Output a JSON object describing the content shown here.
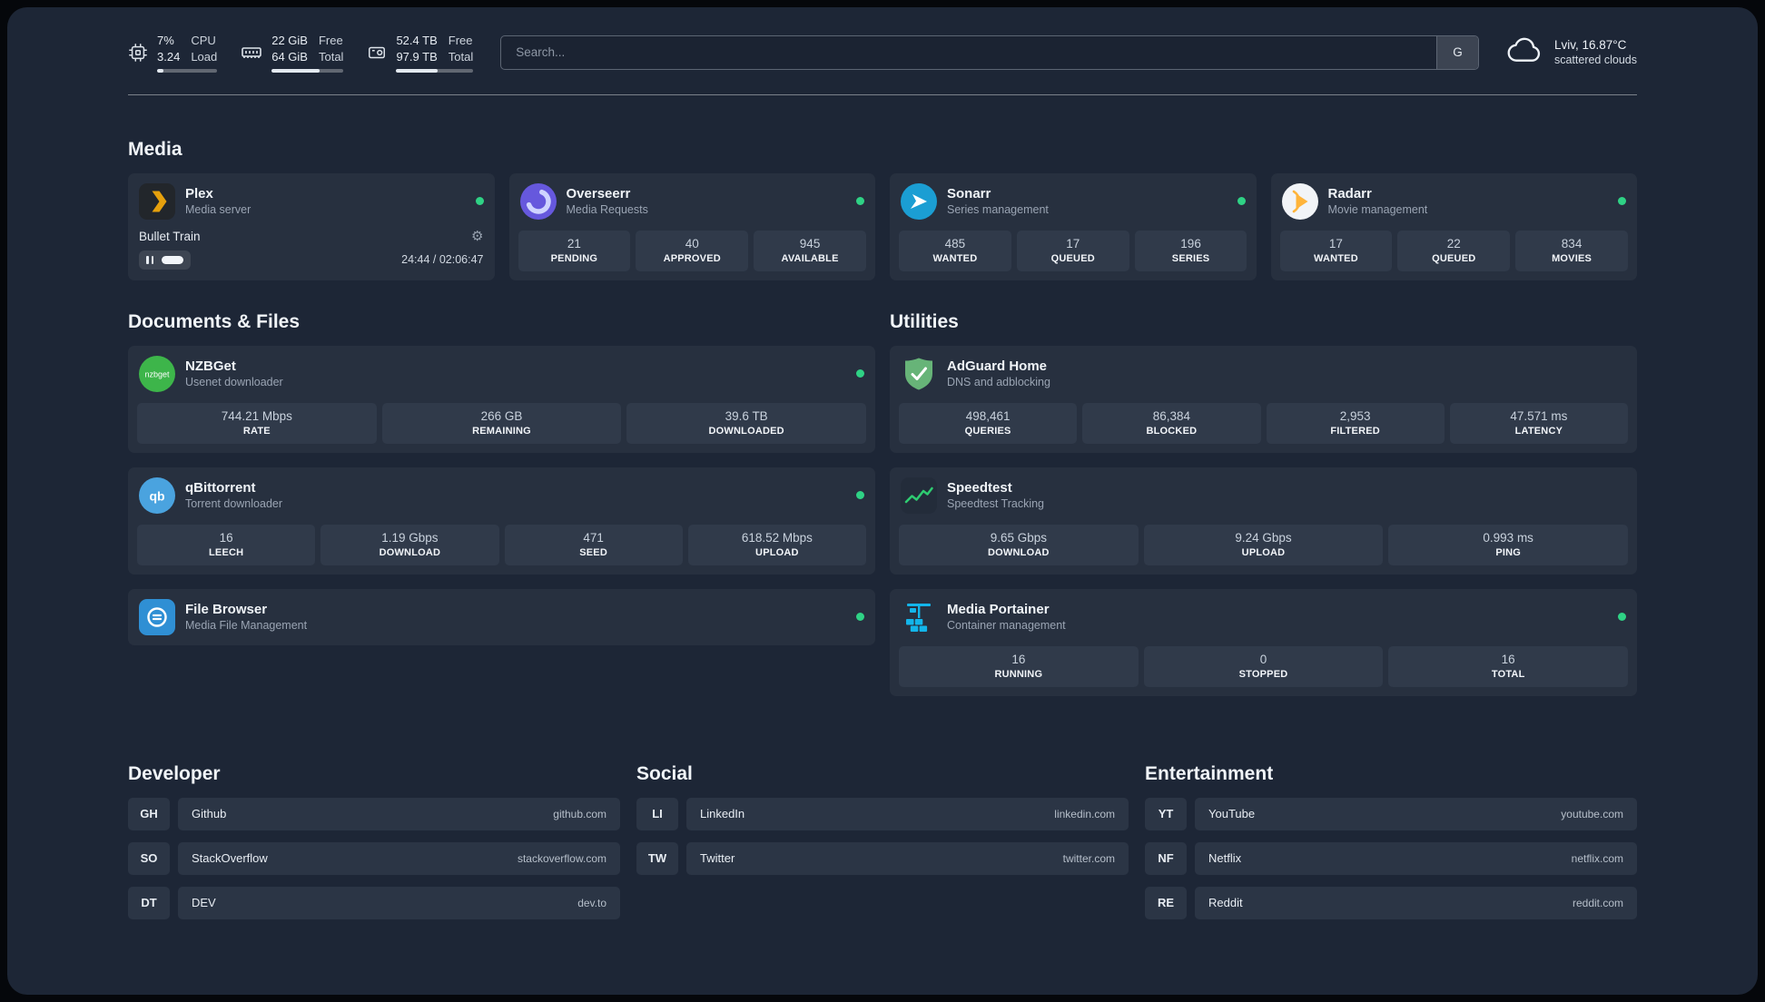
{
  "theme": {
    "background": "#1d2636",
    "card": "#27303f",
    "tile": "#303a4a",
    "status_green": "#2fd285",
    "plex_gold": "#e5a00d",
    "overseerr_purple": "#6658dd",
    "sonarr_blue": "#1b9ed3",
    "radarr_orange": "#ffb43a",
    "nzbget_green": "#3db54a",
    "qbittorrent_blue": "#4aa3df",
    "filebrowser_blue": "#2f8fd4",
    "adguard_green": "#67b478",
    "speedtest_green": "#2ecc71",
    "portainer_blue": "#13b5ea"
  },
  "topbar": {
    "cpu": {
      "percent": "7%",
      "load": "3.24",
      "label_top": "CPU",
      "label_bottom": "Load"
    },
    "memory": {
      "free": "22 GiB",
      "total": "64 GiB",
      "label_top": "Free",
      "label_bottom": "Total"
    },
    "disk": {
      "free": "52.4 TB",
      "total": "97.9 TB",
      "label_top": "Free",
      "label_bottom": "Total"
    },
    "search": {
      "placeholder": "Search...",
      "button_label": "G"
    },
    "weather": {
      "location": "Lviv, 16.87°C",
      "condition": "scattered clouds"
    }
  },
  "sections": {
    "media": {
      "title": "Media",
      "cards": [
        {
          "name": "Plex",
          "subtitle": "Media server",
          "icon": "plex-icon",
          "status": "online",
          "player": {
            "track": "Bullet Train",
            "time": "24:44 / 02:06:47"
          }
        },
        {
          "name": "Overseerr",
          "subtitle": "Media Requests",
          "icon": "overseerr-icon",
          "status": "online",
          "stats": [
            {
              "value": "21",
              "label": "PENDING"
            },
            {
              "value": "40",
              "label": "APPROVED"
            },
            {
              "value": "945",
              "label": "AVAILABLE"
            }
          ]
        },
        {
          "name": "Sonarr",
          "subtitle": "Series management",
          "icon": "sonarr-icon",
          "status": "online",
          "stats": [
            {
              "value": "485",
              "label": "WANTED"
            },
            {
              "value": "17",
              "label": "QUEUED"
            },
            {
              "value": "196",
              "label": "SERIES"
            }
          ]
        },
        {
          "name": "Radarr",
          "subtitle": "Movie management",
          "icon": "radarr-icon",
          "status": "online",
          "stats": [
            {
              "value": "17",
              "label": "WANTED"
            },
            {
              "value": "22",
              "label": "QUEUED"
            },
            {
              "value": "834",
              "label": "MOVIES"
            }
          ]
        }
      ]
    },
    "documents": {
      "title": "Documents & Files",
      "cards": [
        {
          "name": "NZBGet",
          "subtitle": "Usenet downloader",
          "icon": "nzbget-icon",
          "status": "online",
          "stats": [
            {
              "value": "744.21 Mbps",
              "label": "RATE"
            },
            {
              "value": "266 GB",
              "label": "REMAINING"
            },
            {
              "value": "39.6 TB",
              "label": "DOWNLOADED"
            }
          ]
        },
        {
          "name": "qBittorrent",
          "subtitle": "Torrent downloader",
          "icon": "qbittorrent-icon",
          "status": "online",
          "stats": [
            {
              "value": "16",
              "label": "LEECH"
            },
            {
              "value": "1.19 Gbps",
              "label": "DOWNLOAD"
            },
            {
              "value": "471",
              "label": "SEED"
            },
            {
              "value": "618.52 Mbps",
              "label": "UPLOAD"
            }
          ]
        },
        {
          "name": "File Browser",
          "subtitle": "Media File Management",
          "icon": "filebrowser-icon",
          "status": "online"
        }
      ]
    },
    "utilities": {
      "title": "Utilities",
      "cards": [
        {
          "name": "AdGuard Home",
          "subtitle": "DNS and adblocking",
          "icon": "adguard-icon",
          "stats": [
            {
              "value": "498,461",
              "label": "QUERIES"
            },
            {
              "value": "86,384",
              "label": "BLOCKED"
            },
            {
              "value": "2,953",
              "label": "FILTERED"
            },
            {
              "value": "47.571 ms",
              "label": "LATENCY"
            }
          ]
        },
        {
          "name": "Speedtest",
          "subtitle": "Speedtest Tracking",
          "icon": "speedtest-icon",
          "stats": [
            {
              "value": "9.65 Gbps",
              "label": "DOWNLOAD"
            },
            {
              "value": "9.24 Gbps",
              "label": "UPLOAD"
            },
            {
              "value": "0.993 ms",
              "label": "PING"
            }
          ]
        },
        {
          "name": "Media Portainer",
          "subtitle": "Container management",
          "icon": "portainer-icon",
          "status": "online",
          "stats": [
            {
              "value": "16",
              "label": "RUNNING"
            },
            {
              "value": "0",
              "label": "STOPPED"
            },
            {
              "value": "16",
              "label": "TOTAL"
            }
          ]
        }
      ]
    }
  },
  "bookmarks": {
    "groups": [
      {
        "title": "Developer",
        "items": [
          {
            "abbr": "GH",
            "name": "Github",
            "url": "github.com"
          },
          {
            "abbr": "SO",
            "name": "StackOverflow",
            "url": "stackoverflow.com"
          },
          {
            "abbr": "DT",
            "name": "DEV",
            "url": "dev.to"
          }
        ]
      },
      {
        "title": "Social",
        "items": [
          {
            "abbr": "LI",
            "name": "LinkedIn",
            "url": "linkedin.com"
          },
          {
            "abbr": "TW",
            "name": "Twitter",
            "url": "twitter.com"
          }
        ]
      },
      {
        "title": "Entertainment",
        "items": [
          {
            "abbr": "YT",
            "name": "YouTube",
            "url": "youtube.com"
          },
          {
            "abbr": "NF",
            "name": "Netflix",
            "url": "netflix.com"
          },
          {
            "abbr": "RE",
            "name": "Reddit",
            "url": "reddit.com"
          }
        ]
      }
    ]
  }
}
